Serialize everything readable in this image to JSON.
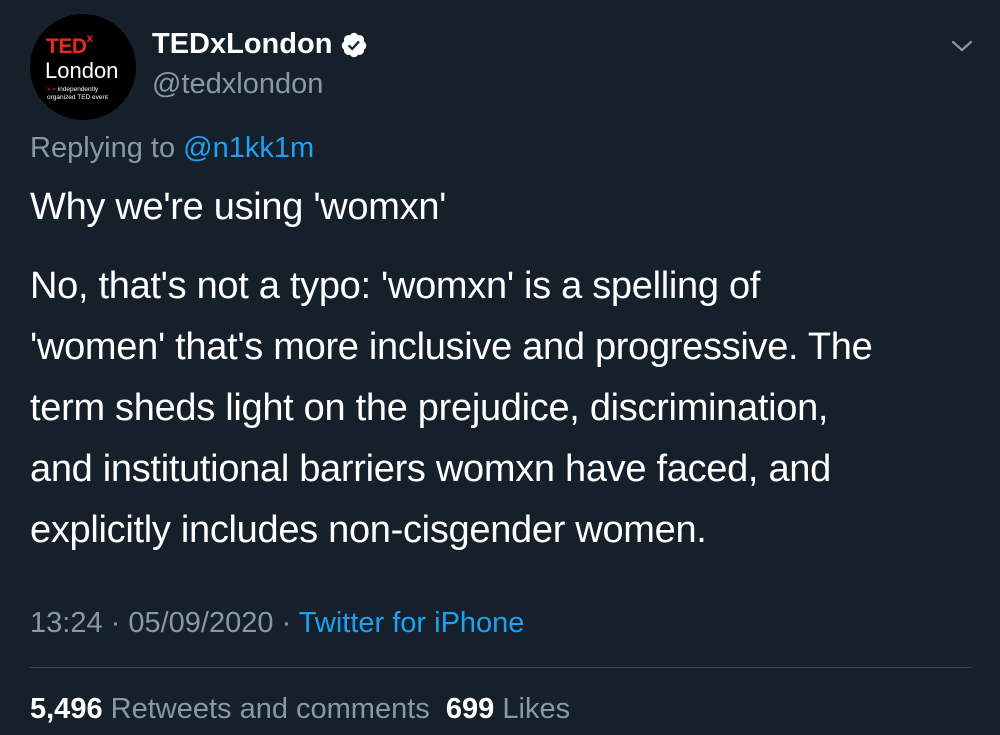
{
  "account": {
    "display_name": "TEDxLondon",
    "handle": "@tedxlondon",
    "avatar": {
      "brand": "TED",
      "brand_sup": "x",
      "city": "London",
      "tagline_mark": "x =",
      "tagline_1": "independently",
      "tagline_2": "organized TED event"
    }
  },
  "reply": {
    "prefix": "Replying to",
    "mention": "@n1kk1m"
  },
  "tweet": {
    "title": "Why we're using 'womxn'",
    "body_lines": [
      "No, that's not a typo: 'womxn' is a spelling of",
      "'women' that's more inclusive and progressive. The",
      "term sheds light on the prejudice, discrimination,",
      "and institutional barriers womxn have faced, and",
      "explicitly includes non-cisgender women."
    ]
  },
  "meta": {
    "time": "13:24",
    "sep1": " · ",
    "date": "05/09/2020",
    "sep2": " · ",
    "source": "Twitter for iPhone"
  },
  "stats": {
    "retweets_count": "5,496",
    "retweets_label": "Retweets and comments",
    "likes_count": "699",
    "likes_label": "Likes"
  },
  "icons": {
    "verified": "verified-badge-icon",
    "chevron": "chevron-down-icon"
  },
  "colors": {
    "background": "#15202b",
    "accent": "#1da1f2",
    "secondary_text": "#8899a6",
    "ted_red": "#e62b1e"
  }
}
